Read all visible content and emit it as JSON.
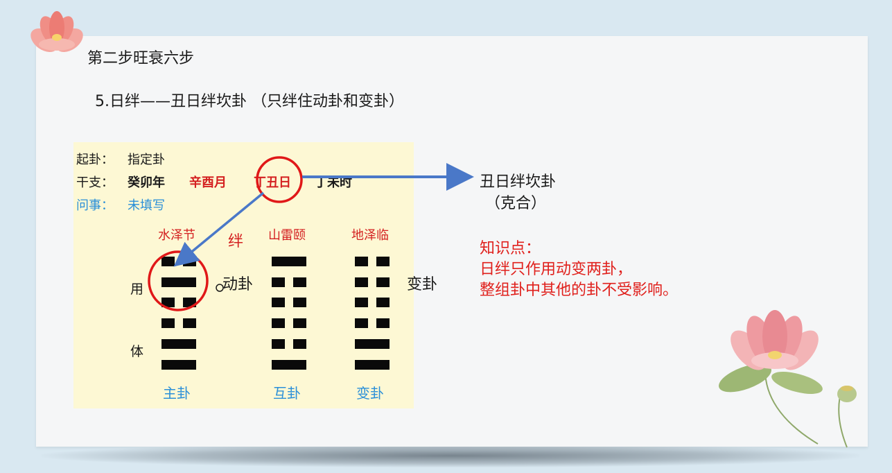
{
  "slide": {
    "title": "第二步旺衰六步",
    "subtitle": "5.日绊——丑日绊坎卦 （只绊住动卦和变卦）"
  },
  "panel": {
    "qigua_label": "起卦：",
    "qigua_value": "指定卦",
    "ganzhi_label": "干支：",
    "ganzhi": [
      "癸卯年",
      "辛酉月",
      "丁丑日",
      "丁未时"
    ],
    "wenshi_label": "问事：",
    "wenshi_value": "未填写",
    "gua_names": [
      "水泽节",
      "山雷颐",
      "地泽临"
    ],
    "ban_mark": "绊",
    "yong_label": "用",
    "ti_label": "体",
    "dong_label": "动卦",
    "bian_label": "变卦",
    "footer_labels": [
      "主卦",
      "互卦",
      "变卦"
    ],
    "hexagrams": {
      "main": [
        "yin",
        "yang",
        "yin",
        "yin",
        "yang",
        "yang"
      ],
      "mutual": [
        "yang",
        "yin",
        "yin",
        "yin",
        "yin",
        "yang"
      ],
      "changed": [
        "yin",
        "yin",
        "yin",
        "yin",
        "yang",
        "yang"
      ]
    }
  },
  "right": {
    "line1": "丑日绊坎卦",
    "line2": "（克合）",
    "knowledge_title": "知识点：",
    "knowledge_line1": "日绊只作用动变两卦，",
    "knowledge_line2": "整组卦中其他的卦不受影响。"
  },
  "colors": {
    "background": "#d9e8f1",
    "panel": "#fdf8d4",
    "highlight_red": "#d42020",
    "arrow_blue": "#4a78c8",
    "label_blue": "#2a8fd8"
  }
}
